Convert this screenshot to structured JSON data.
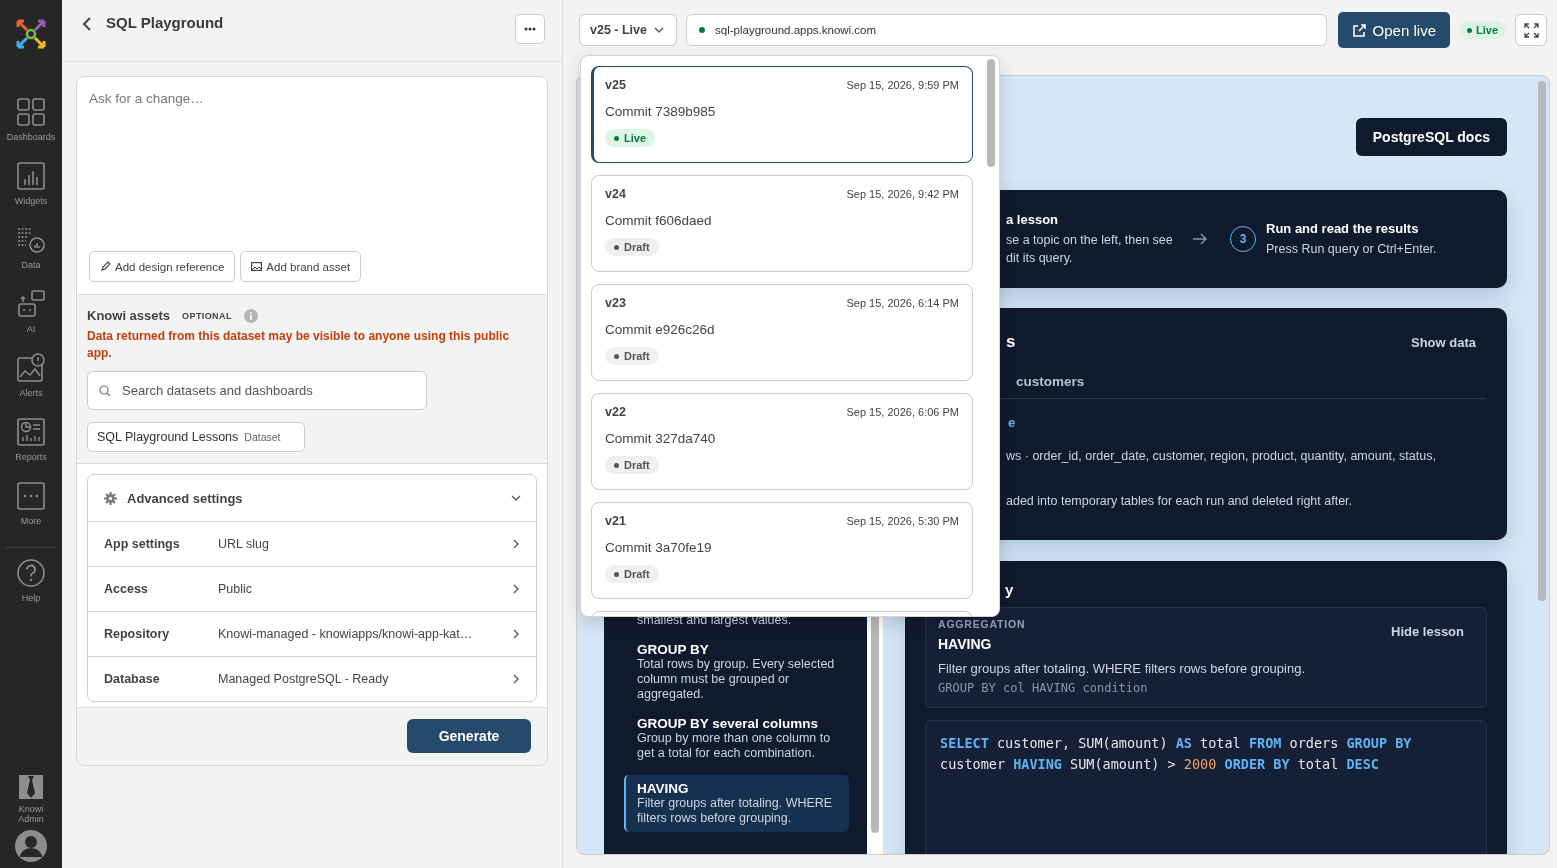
{
  "nav": {
    "items": [
      {
        "label": "Dashboards"
      },
      {
        "label": "Widgets"
      },
      {
        "label": "Data"
      },
      {
        "label": "AI"
      },
      {
        "label": "Alerts"
      },
      {
        "label": "Reports"
      },
      {
        "label": "More"
      }
    ],
    "help": {
      "label": "Help"
    },
    "account": {
      "label": "Knowi Admin"
    }
  },
  "editor": {
    "title": "SQL Playground",
    "prompt": {
      "placeholder": "Ask for a change…"
    },
    "attachments": [
      "Add design reference",
      "Add brand asset"
    ],
    "assets": {
      "title": "Knowi assets",
      "badge": "OPTIONAL",
      "warning": "Data returned from this dataset may be visible to anyone using this public app.",
      "search": {
        "placeholder": "Search datasets and dashboards"
      },
      "selected": [
        {
          "name": "SQL Playground Lessons",
          "type": "Dataset"
        }
      ]
    },
    "advanced": {
      "title": "Advanced settings",
      "expanded": true,
      "rows": [
        {
          "label": "App settings",
          "value": "URL slug"
        },
        {
          "label": "Access",
          "value": "Public"
        },
        {
          "label": "Repository",
          "value": "Knowi-managed - knowiapps/knowi-app-kat…"
        },
        {
          "label": "Database",
          "value": "Managed PostgreSQL - Ready"
        }
      ]
    },
    "generate": "Generate"
  },
  "preview_bar": {
    "version": "v25 - Live",
    "url": "sql-playground.apps.knowi.com",
    "open_button": "Open live",
    "status": "Live"
  },
  "versions": [
    {
      "version": "v25",
      "date": "Sep 15, 2026, 9:59 PM",
      "commit": "Commit 7389b985",
      "status": {
        "kind": "live",
        "label": "Live"
      },
      "selected": true
    },
    {
      "version": "v24",
      "date": "Sep 15, 2026, 9:42 PM",
      "commit": "Commit f606daed",
      "status": {
        "kind": "draft",
        "label": "Draft"
      },
      "selected": false
    },
    {
      "version": "v23",
      "date": "Sep 15, 2026, 6:14 PM",
      "commit": "Commit e926c26d",
      "status": {
        "kind": "draft",
        "label": "Draft"
      },
      "selected": false
    },
    {
      "version": "v22",
      "date": "Sep 15, 2026, 6:06 PM",
      "commit": "Commit 327da740",
      "status": {
        "kind": "draft",
        "label": "Draft"
      },
      "selected": false
    },
    {
      "version": "v21",
      "date": "Sep 15, 2026, 5:30 PM",
      "commit": "Commit 3a70fe19",
      "status": {
        "kind": "draft",
        "label": "Draft"
      },
      "selected": false
    }
  ],
  "preview": {
    "docs_button": "PostgreSQL docs",
    "steps": [
      {
        "title": "a lesson",
        "lines": [
          "se a topic on the left, then see",
          "dit its query."
        ]
      },
      {
        "number": "3",
        "title": "Run and read the results",
        "lines": [
          "Press Run query or Ctrl+Enter."
        ]
      }
    ],
    "data_card": {
      "title": "s",
      "action": "Show data",
      "tabs": [
        {
          "label": "customers",
          "selected": false
        }
      ],
      "link": "e",
      "lines": [
        "ws · order_id, order_date, customer, region, product, quantity, amount, status,",
        "aded into temporary tables for each run and deleted right after."
      ]
    },
    "lesson_card": {
      "title": "y",
      "topics": [
        {
          "text": "smallest and largest values.",
          "selected": false
        },
        {
          "title": "GROUP BY",
          "text": "Total rows by group. Every selected column must be grouped or aggregated.",
          "selected": false
        },
        {
          "title": "GROUP BY several columns",
          "text": "Group by more than one column to get a total for each combination.",
          "selected": false
        },
        {
          "title": "HAVING",
          "text": "Filter groups after totaling. WHERE filters rows before grouping.",
          "selected": true
        }
      ],
      "lesson": {
        "category": "AGGREGATION",
        "title": "HAVING",
        "text": "Filter groups after totaling. WHERE filters rows before grouping.",
        "syntax": "GROUP BY col HAVING condition",
        "hide": "Hide lesson"
      },
      "query": [
        [
          {
            "text": "SELECT",
            "kind": "keyword"
          },
          {
            "text": " customer, SUM(amount) ",
            "kind": "plain"
          },
          {
            "text": "AS",
            "kind": "keyword"
          },
          {
            "text": " total ",
            "kind": "plain"
          },
          {
            "text": "FROM",
            "kind": "keyword"
          },
          {
            "text": " orders ",
            "kind": "plain"
          },
          {
            "text": "GROUP BY",
            "kind": "keyword"
          }
        ],
        [
          {
            "text": "customer ",
            "kind": "plain"
          },
          {
            "text": "HAVING",
            "kind": "keyword"
          },
          {
            "text": " SUM(amount) > ",
            "kind": "plain"
          },
          {
            "text": "2000",
            "kind": "number"
          },
          {
            "text": " ORDER BY",
            "kind": "keyword"
          },
          {
            "text": " total ",
            "kind": "plain"
          },
          {
            "text": "DESC",
            "kind": "keyword"
          }
        ]
      ]
    }
  }
}
